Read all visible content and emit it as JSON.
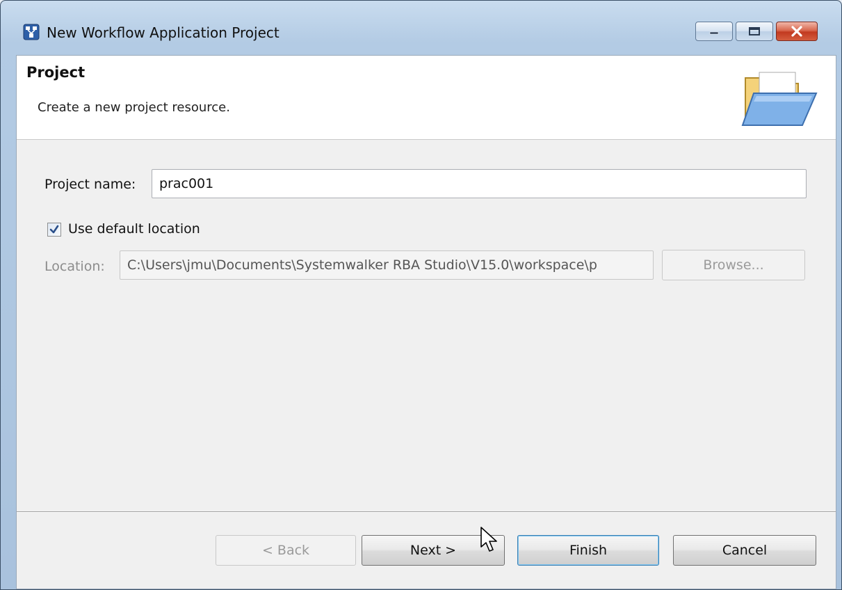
{
  "window": {
    "title": "New Workflow Application Project",
    "icon": "workflow-app-icon",
    "controls": [
      "minimize-icon",
      "maximize-icon",
      "close-icon"
    ]
  },
  "banner": {
    "title": "Project",
    "description": "Create a new project resource.",
    "icon": "folder-open-icon"
  },
  "form": {
    "project_name_label": "Project name:",
    "project_name_value": "prac001",
    "use_default_location_label": "Use default location",
    "use_default_location_checked": true,
    "location_label": "Location:",
    "location_value": "C:\\Users\\jmu\\Documents\\Systemwalker RBA Studio\\V15.0\\workspace\\p",
    "browse_label": "Browse..."
  },
  "buttons": {
    "back_label": "< Back",
    "next_label": "Next >",
    "finish_label": "Finish",
    "cancel_label": "Cancel"
  },
  "colors": {
    "titlebar": "#b3cbe4",
    "close_button": "#c23a20",
    "default_button_border": "#3c7fb1"
  }
}
